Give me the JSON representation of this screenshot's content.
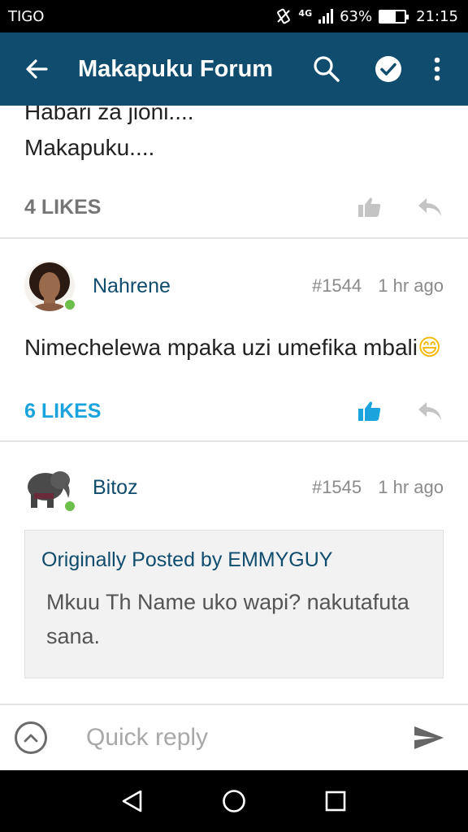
{
  "status": {
    "carrier": "TIGO",
    "network": "4G",
    "battery_percent_label": "63%",
    "battery_level": 0.63,
    "time": "21:15"
  },
  "app_bar": {
    "title": "Makapuku Forum"
  },
  "posts": [
    {
      "text_lines": [
        "Habari za jioni....",
        "Makapuku...."
      ],
      "likes": "4 LIKES",
      "liked": false
    },
    {
      "username": "Nahrene",
      "number": "#1544",
      "time": "1 hr ago",
      "text": "Nimechelewa mpaka uzi umefika mbali",
      "emoji": "😄",
      "likes": "6 LIKES",
      "liked": true
    },
    {
      "username": "Bitoz",
      "number": "#1545",
      "time": "1 hr ago",
      "quote": {
        "title": "Originally Posted by EMMYGUY",
        "text": "Mkuu Th Name uko wapi? nakutafuta sana."
      }
    }
  ],
  "quick_reply": {
    "placeholder": "Quick reply"
  },
  "colors": {
    "app_bar": "#0f4c6d",
    "accent": "#1aa3dd",
    "online": "#6cc04a"
  },
  "icons": [
    "back-arrow-icon",
    "search-icon",
    "check-circle-icon",
    "more-vert-icon",
    "thumbs-up-icon",
    "reply-icon",
    "chevron-up-icon",
    "send-icon",
    "nav-back-icon",
    "nav-home-icon",
    "nav-recents-icon"
  ]
}
